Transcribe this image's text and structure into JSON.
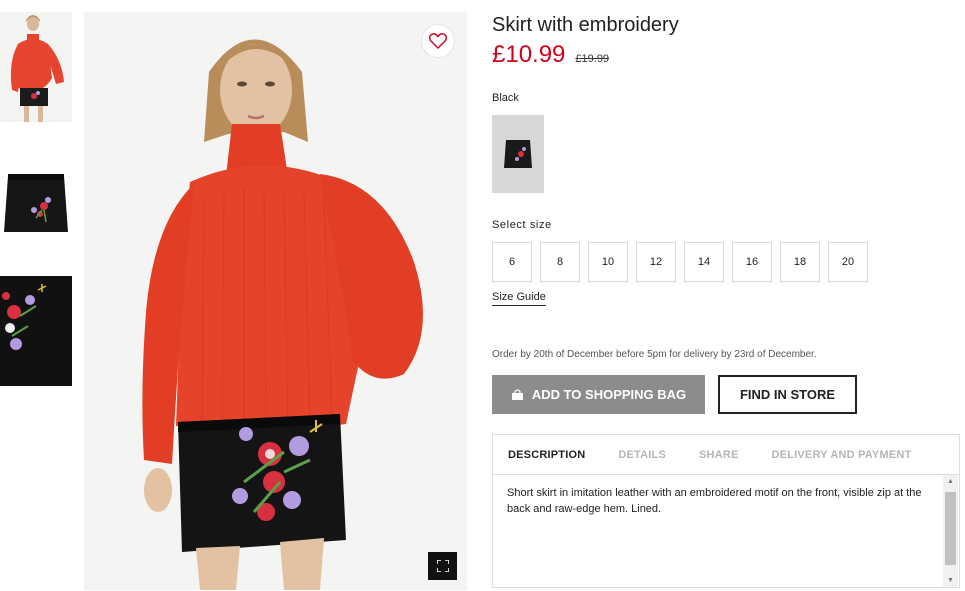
{
  "product": {
    "title": "Skirt with embroidery",
    "price": "£10.99",
    "old_price": "£19.99",
    "color_name": "Black",
    "accent_color": "#d0021b"
  },
  "sizes": {
    "label": "Select size",
    "options": [
      "6",
      "8",
      "10",
      "12",
      "14",
      "16",
      "18",
      "20"
    ],
    "guide_label": "Size Guide"
  },
  "delivery_note": "Order by 20th of December before 5pm for delivery by 23rd of December.",
  "actions": {
    "add_to_bag": "ADD TO SHOPPING BAG",
    "find_in_store": "FIND IN STORE"
  },
  "tabs": {
    "items": [
      "DESCRIPTION",
      "DETAILS",
      "SHARE",
      "DELIVERY AND PAYMENT"
    ],
    "active": "DESCRIPTION"
  },
  "description": "Short skirt in imitation leather with an embroidered motif on the front, visible zip at the back and raw-edge hem. Lined.",
  "icons": {
    "favorite": "heart-icon",
    "zoom": "fullscreen-icon",
    "bag": "shopping-bag-icon"
  }
}
